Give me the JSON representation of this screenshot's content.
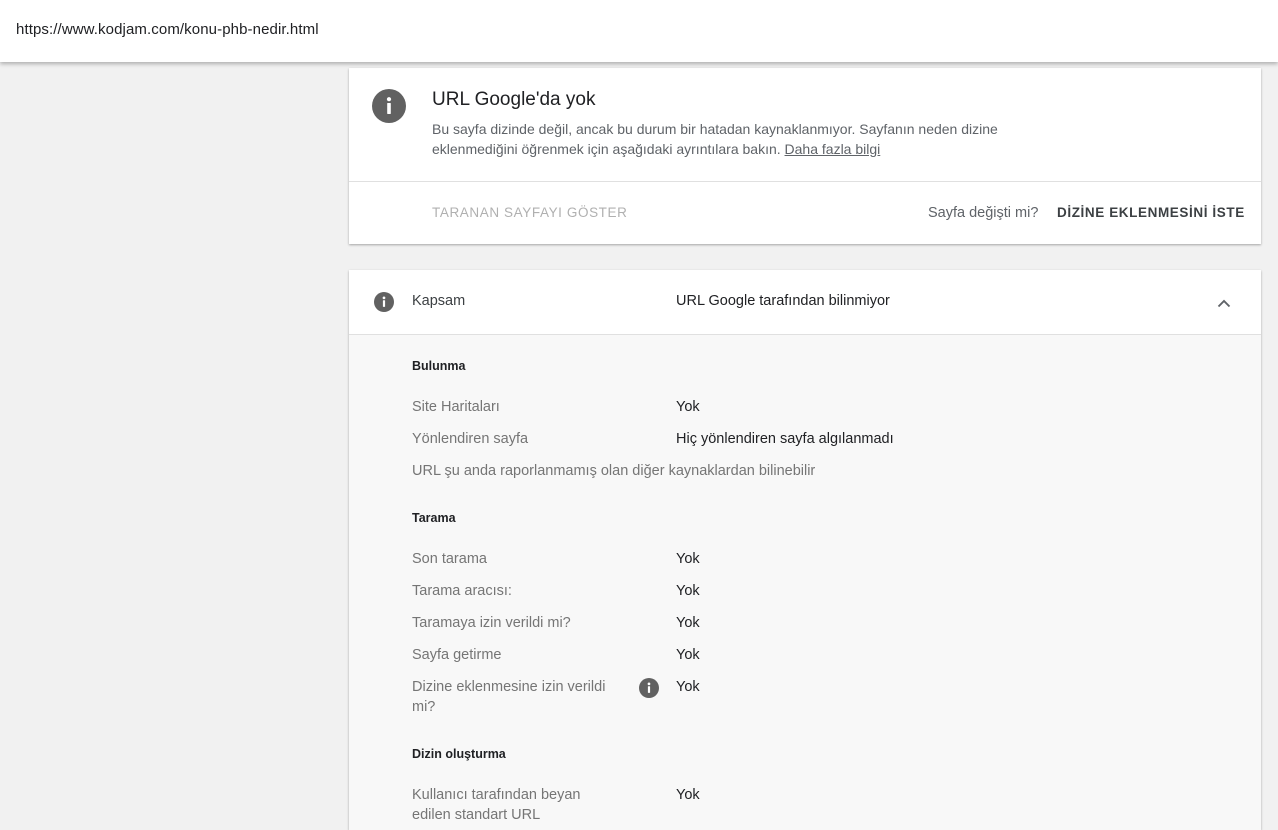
{
  "address_bar": {
    "url": "https://www.kodjam.com/konu-phb-nedir.html"
  },
  "status_card": {
    "icon": "info-icon",
    "title": "URL Google'da yok",
    "description": "Bu sayfa dizinde değil, ancak bu durum bir hatadan kaynaklanmıyor. Sayfanın neden dizine eklenmediğini öğrenmek için aşağıdaki ayrıntılara bakın.",
    "link_label": "Daha fazla bilgi",
    "view_crawled_label": "TARANAN SAYFAYI GÖSTER",
    "page_changed_question": "Sayfa değişti mi?",
    "request_indexing_label": "DİZİNE EKLENMESİNİ İSTE"
  },
  "coverage": {
    "icon": "info-icon",
    "label": "Kapsam",
    "value": "URL Google tarafından bilinmiyor",
    "expanded": true,
    "discovery": {
      "title": "Bulunma",
      "rows": [
        {
          "label": "Site Haritaları",
          "value": "Yok"
        },
        {
          "label": "Yönlendiren sayfa",
          "value": "Hiç yönlendiren sayfa algılanmadı"
        }
      ],
      "note": "URL şu anda raporlanmamış olan diğer kaynaklardan bilinebilir"
    },
    "crawl": {
      "title": "Tarama",
      "rows": [
        {
          "label": "Son tarama",
          "value": "Yok"
        },
        {
          "label": "Tarama aracısı:",
          "value": "Yok"
        },
        {
          "label": "Taramaya izin verildi mi?",
          "value": "Yok"
        },
        {
          "label": "Sayfa getirme",
          "value": "Yok"
        },
        {
          "label": "Dizine eklenmesine izin verildi mi?",
          "value": "Yok"
        }
      ]
    },
    "indexing": {
      "title": "Dizin oluşturma",
      "rows": [
        {
          "label": "Kullanıcı tarafından beyan edilen standart URL",
          "value": "Yok"
        }
      ]
    }
  },
  "colors": {
    "icon_gray": "#616161",
    "label_gray": "#757575",
    "background": "#f1f1f1"
  }
}
